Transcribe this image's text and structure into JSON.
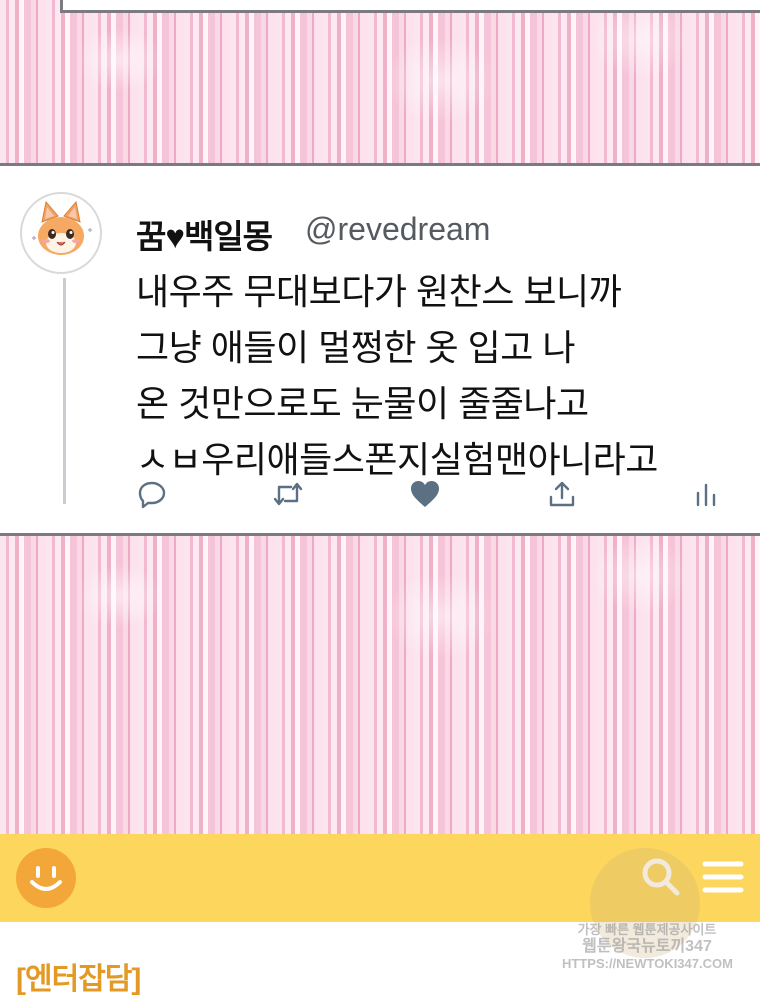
{
  "tweet": {
    "display_name": "꿈♥백일몽",
    "handle": "@revedream",
    "lines": [
      "내우주 무대보다가 원찬스 보니까",
      "그냥 애들이 멀쩡한 옷 입고 나",
      "온 것만으로도 눈물이 줄줄나고",
      "ㅅㅂ우리애들스폰지실험맨아니라고"
    ],
    "actions": [
      "reply-icon",
      "retweet-icon",
      "like-icon",
      "share-icon",
      "analytics-icon"
    ],
    "liked_color": "#5b7083"
  },
  "app_bar": {
    "color": "#fdd65e",
    "logo_icon": "smile-logo-icon",
    "search_icon": "search-icon",
    "menu_icon": "menu-icon"
  },
  "content": {
    "category": "[엔터잡담]"
  },
  "watermark": {
    "line1": "가장 빠른 웹툰제공사이트",
    "line2": "웹툰왕국뉴토끼347",
    "line3": "HTTPS://NEWTOKI347.COM"
  }
}
